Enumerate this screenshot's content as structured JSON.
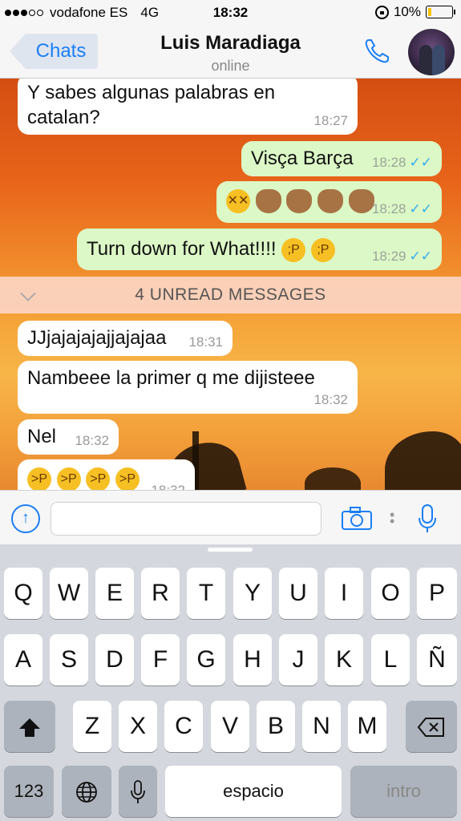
{
  "status": {
    "carrier": "vodafone ES",
    "network": "4G",
    "time": "18:32",
    "battery": "10%",
    "signal_dots": 3
  },
  "nav": {
    "back_label": "Chats",
    "contact_name": "Luis Maradiaga",
    "contact_status": "online"
  },
  "messages": [
    {
      "dir": "in",
      "text": "Y sabes algunas palabras en catalan?",
      "time": "18:27"
    },
    {
      "dir": "out",
      "text": "Visça Barça",
      "time": "18:28",
      "read": true
    },
    {
      "dir": "out",
      "text": "",
      "emoji": [
        "dizzy-face",
        "clap",
        "clap",
        "clap",
        "clap"
      ],
      "time": "18:28",
      "read": true
    },
    {
      "dir": "out",
      "text": "Turn down for What!!!!",
      "emoji": [
        "winking-tongue",
        "winking-tongue"
      ],
      "time": "18:29",
      "read": true
    },
    {
      "dir": "in",
      "text": "JJjajajajajjajajaa",
      "time": "18:31"
    },
    {
      "dir": "in",
      "text": "Nambeee la primer q me dijisteee",
      "time": "18:32"
    },
    {
      "dir": "in",
      "text": "Nel",
      "time": "18:32"
    },
    {
      "dir": "in",
      "text": "",
      "emoji": [
        "squinting-tongue",
        "squinting-tongue",
        "squinting-tongue",
        "squinting-tongue"
      ],
      "time": "18:32"
    }
  ],
  "unread_banner": "4 UNREAD MESSAGES",
  "input": {
    "value": "",
    "placeholder": ""
  },
  "keyboard": {
    "row1": [
      "Q",
      "W",
      "E",
      "R",
      "T",
      "Y",
      "U",
      "I",
      "O",
      "P"
    ],
    "row2": [
      "A",
      "S",
      "D",
      "F",
      "G",
      "H",
      "J",
      "K",
      "L",
      "Ñ"
    ],
    "row3": [
      "Z",
      "X",
      "C",
      "V",
      "B",
      "N",
      "M"
    ],
    "numbers_label": "123",
    "space_label": "espacio",
    "return_label": "intro"
  },
  "colors": {
    "accent": "#1a7ef7",
    "outgoing_bubble": "#dcf8c6",
    "incoming_bubble": "#ffffff",
    "read_ticks": "#34aaf0"
  }
}
